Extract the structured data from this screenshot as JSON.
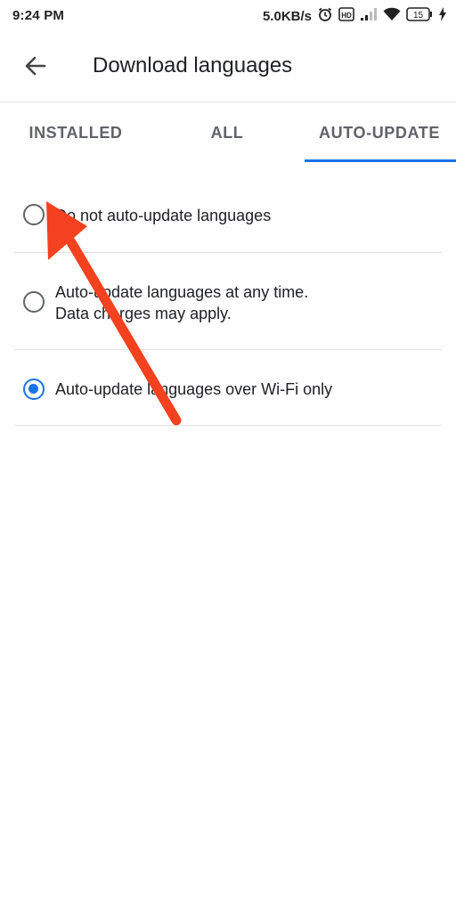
{
  "status_bar": {
    "time": "9:24 PM",
    "network_speed": "5.0KB/s",
    "battery_level": "15",
    "icons": [
      "alarm-icon",
      "hd-icon",
      "signal-icon",
      "wifi-icon",
      "battery-icon",
      "charging-icon"
    ]
  },
  "app_bar": {
    "title": "Download languages",
    "back_icon": "arrow-back-icon"
  },
  "tabs": [
    {
      "label": "INSTALLED",
      "selected": false
    },
    {
      "label": "ALL",
      "selected": false
    },
    {
      "label": "AUTO-UPDATE",
      "selected": true
    }
  ],
  "options": [
    {
      "line1": "Do not auto-update languages",
      "line2": "",
      "selected": false
    },
    {
      "line1": "Auto-update languages at any time.",
      "line2": "Data charges may apply.",
      "selected": false
    },
    {
      "line1": "Auto-update languages over Wi-Fi only",
      "line2": "",
      "selected": true
    }
  ],
  "colors": {
    "accent": "#1a73e8",
    "annotation_arrow": "#f4411f"
  }
}
